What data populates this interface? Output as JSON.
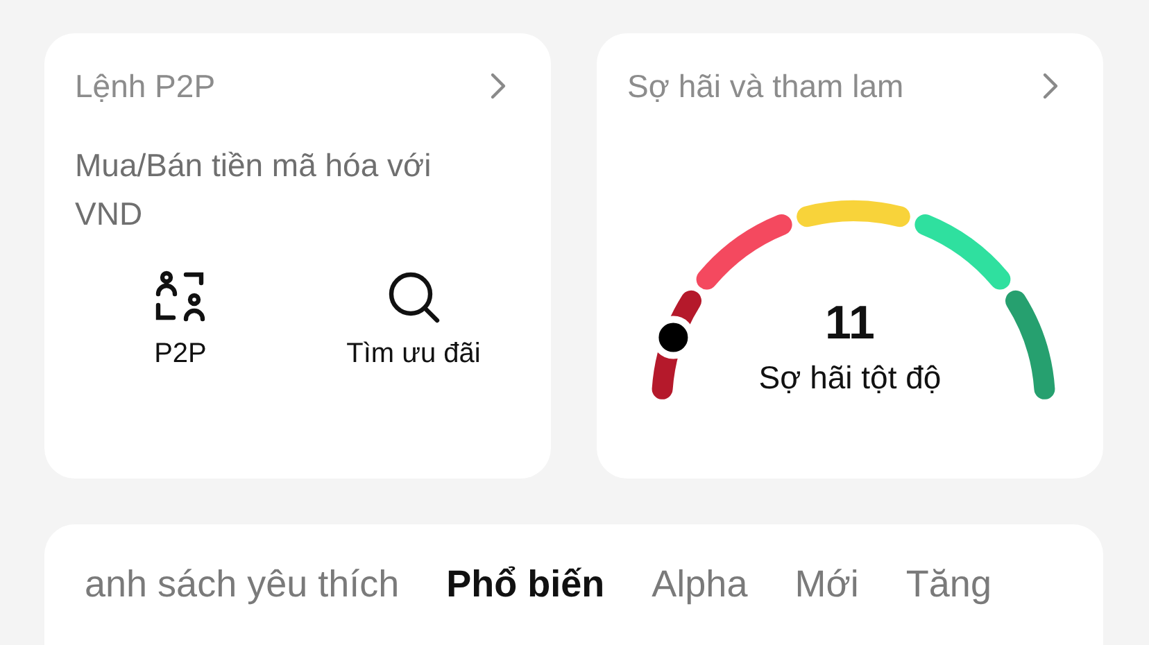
{
  "p2p_card": {
    "title": "Lệnh P2P",
    "description": "Mua/Bán tiền mã hóa với VND",
    "actions": [
      {
        "kind": "p2p",
        "label": "P2P"
      },
      {
        "kind": "search",
        "label": "Tìm ưu đãi"
      }
    ]
  },
  "fear_greed_card": {
    "title": "Sợ hãi và tham lam",
    "value": "11",
    "status": "Sợ hãi tột độ",
    "level": 0.11
  },
  "market_tabs": [
    {
      "label": "anh sách yêu thích",
      "selected": false
    },
    {
      "label": "Phổ biến",
      "selected": true
    },
    {
      "label": "Alpha",
      "selected": false
    },
    {
      "label": "Mới",
      "selected": false
    },
    {
      "label": "Tăng",
      "selected": false
    }
  ]
}
